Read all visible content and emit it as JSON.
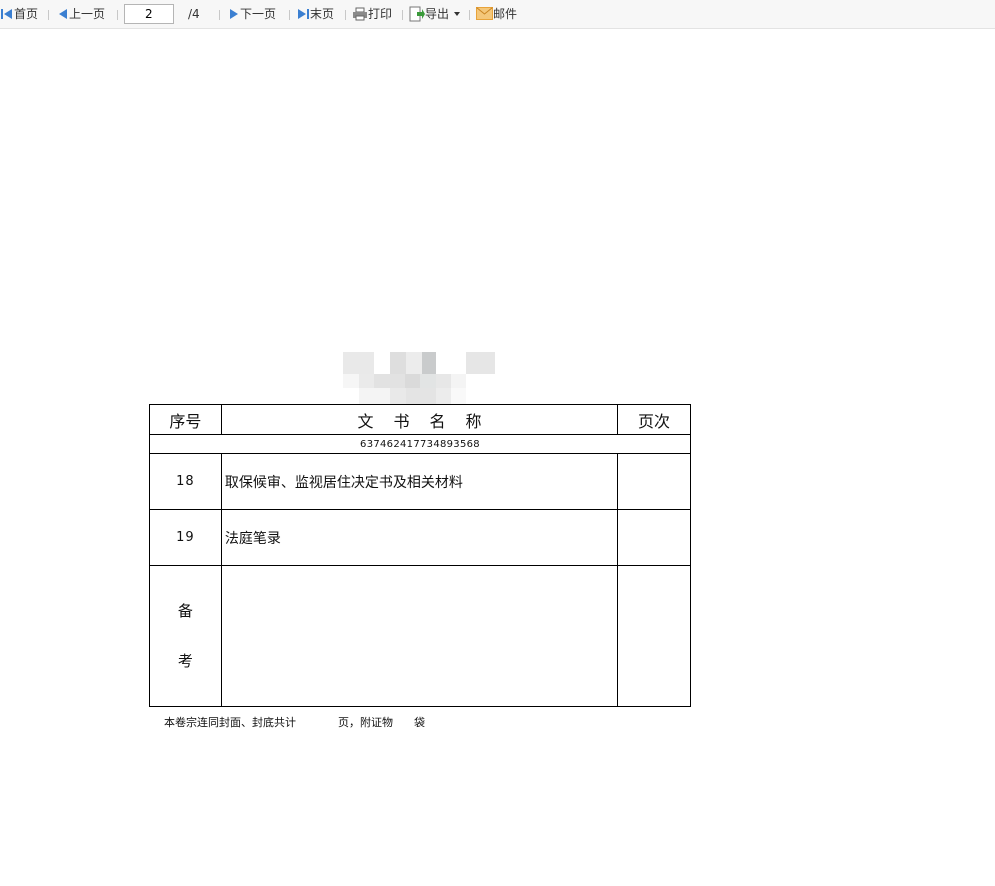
{
  "toolbar": {
    "first_label": "首页",
    "prev_label": "上一页",
    "current_page": "2",
    "total_pages": "/4",
    "next_label": "下一页",
    "last_label": "末页",
    "print_label": "打印",
    "export_label": "导出",
    "email_label": "邮件"
  },
  "document": {
    "table": {
      "col_seq": "序号",
      "col_name": "文书名称",
      "col_pages": "页次",
      "code": "637462417734893568",
      "rows": [
        {
          "seq": "18",
          "name": "取保候审、监视居住决定书及相关材料",
          "pages": ""
        },
        {
          "seq": "19",
          "name": "法庭笔录",
          "pages": ""
        }
      ],
      "remark_label_1": "备",
      "remark_label_2": "考"
    },
    "footer": {
      "part1": "本卷宗连同封面、封底共计",
      "part2": "页，附证物",
      "part3": "袋"
    }
  },
  "colors": {
    "toolbar_bg": "#f7f7f7",
    "icon_blue": "#3b7fd1",
    "export_green": "#3a9a3a",
    "mail_orange": "#e8a33a"
  }
}
